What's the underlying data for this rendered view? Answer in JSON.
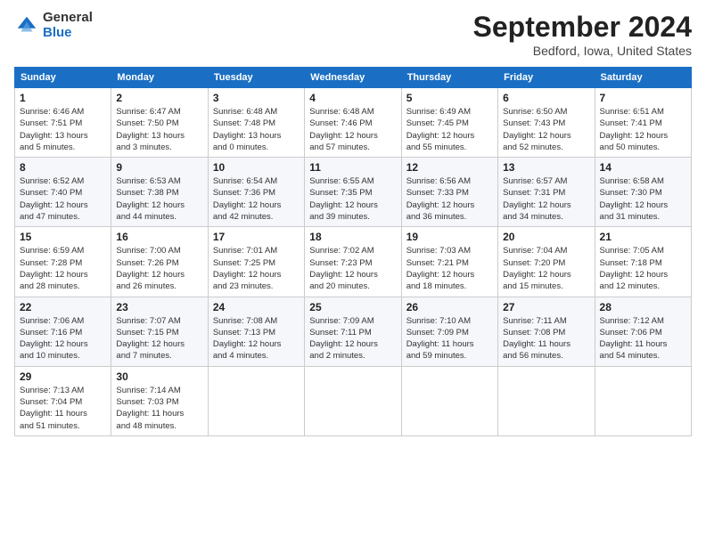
{
  "header": {
    "logo_general": "General",
    "logo_blue": "Blue",
    "title": "September 2024",
    "location": "Bedford, Iowa, United States"
  },
  "weekdays": [
    "Sunday",
    "Monday",
    "Tuesday",
    "Wednesday",
    "Thursday",
    "Friday",
    "Saturday"
  ],
  "weeks": [
    [
      {
        "day": "1",
        "info": "Sunrise: 6:46 AM\nSunset: 7:51 PM\nDaylight: 13 hours\nand 5 minutes."
      },
      {
        "day": "2",
        "info": "Sunrise: 6:47 AM\nSunset: 7:50 PM\nDaylight: 13 hours\nand 3 minutes."
      },
      {
        "day": "3",
        "info": "Sunrise: 6:48 AM\nSunset: 7:48 PM\nDaylight: 13 hours\nand 0 minutes."
      },
      {
        "day": "4",
        "info": "Sunrise: 6:48 AM\nSunset: 7:46 PM\nDaylight: 12 hours\nand 57 minutes."
      },
      {
        "day": "5",
        "info": "Sunrise: 6:49 AM\nSunset: 7:45 PM\nDaylight: 12 hours\nand 55 minutes."
      },
      {
        "day": "6",
        "info": "Sunrise: 6:50 AM\nSunset: 7:43 PM\nDaylight: 12 hours\nand 52 minutes."
      },
      {
        "day": "7",
        "info": "Sunrise: 6:51 AM\nSunset: 7:41 PM\nDaylight: 12 hours\nand 50 minutes."
      }
    ],
    [
      {
        "day": "8",
        "info": "Sunrise: 6:52 AM\nSunset: 7:40 PM\nDaylight: 12 hours\nand 47 minutes."
      },
      {
        "day": "9",
        "info": "Sunrise: 6:53 AM\nSunset: 7:38 PM\nDaylight: 12 hours\nand 44 minutes."
      },
      {
        "day": "10",
        "info": "Sunrise: 6:54 AM\nSunset: 7:36 PM\nDaylight: 12 hours\nand 42 minutes."
      },
      {
        "day": "11",
        "info": "Sunrise: 6:55 AM\nSunset: 7:35 PM\nDaylight: 12 hours\nand 39 minutes."
      },
      {
        "day": "12",
        "info": "Sunrise: 6:56 AM\nSunset: 7:33 PM\nDaylight: 12 hours\nand 36 minutes."
      },
      {
        "day": "13",
        "info": "Sunrise: 6:57 AM\nSunset: 7:31 PM\nDaylight: 12 hours\nand 34 minutes."
      },
      {
        "day": "14",
        "info": "Sunrise: 6:58 AM\nSunset: 7:30 PM\nDaylight: 12 hours\nand 31 minutes."
      }
    ],
    [
      {
        "day": "15",
        "info": "Sunrise: 6:59 AM\nSunset: 7:28 PM\nDaylight: 12 hours\nand 28 minutes."
      },
      {
        "day": "16",
        "info": "Sunrise: 7:00 AM\nSunset: 7:26 PM\nDaylight: 12 hours\nand 26 minutes."
      },
      {
        "day": "17",
        "info": "Sunrise: 7:01 AM\nSunset: 7:25 PM\nDaylight: 12 hours\nand 23 minutes."
      },
      {
        "day": "18",
        "info": "Sunrise: 7:02 AM\nSunset: 7:23 PM\nDaylight: 12 hours\nand 20 minutes."
      },
      {
        "day": "19",
        "info": "Sunrise: 7:03 AM\nSunset: 7:21 PM\nDaylight: 12 hours\nand 18 minutes."
      },
      {
        "day": "20",
        "info": "Sunrise: 7:04 AM\nSunset: 7:20 PM\nDaylight: 12 hours\nand 15 minutes."
      },
      {
        "day": "21",
        "info": "Sunrise: 7:05 AM\nSunset: 7:18 PM\nDaylight: 12 hours\nand 12 minutes."
      }
    ],
    [
      {
        "day": "22",
        "info": "Sunrise: 7:06 AM\nSunset: 7:16 PM\nDaylight: 12 hours\nand 10 minutes."
      },
      {
        "day": "23",
        "info": "Sunrise: 7:07 AM\nSunset: 7:15 PM\nDaylight: 12 hours\nand 7 minutes."
      },
      {
        "day": "24",
        "info": "Sunrise: 7:08 AM\nSunset: 7:13 PM\nDaylight: 12 hours\nand 4 minutes."
      },
      {
        "day": "25",
        "info": "Sunrise: 7:09 AM\nSunset: 7:11 PM\nDaylight: 12 hours\nand 2 minutes."
      },
      {
        "day": "26",
        "info": "Sunrise: 7:10 AM\nSunset: 7:09 PM\nDaylight: 11 hours\nand 59 minutes."
      },
      {
        "day": "27",
        "info": "Sunrise: 7:11 AM\nSunset: 7:08 PM\nDaylight: 11 hours\nand 56 minutes."
      },
      {
        "day": "28",
        "info": "Sunrise: 7:12 AM\nSunset: 7:06 PM\nDaylight: 11 hours\nand 54 minutes."
      }
    ],
    [
      {
        "day": "29",
        "info": "Sunrise: 7:13 AM\nSunset: 7:04 PM\nDaylight: 11 hours\nand 51 minutes."
      },
      {
        "day": "30",
        "info": "Sunrise: 7:14 AM\nSunset: 7:03 PM\nDaylight: 11 hours\nand 48 minutes."
      },
      null,
      null,
      null,
      null,
      null
    ]
  ]
}
